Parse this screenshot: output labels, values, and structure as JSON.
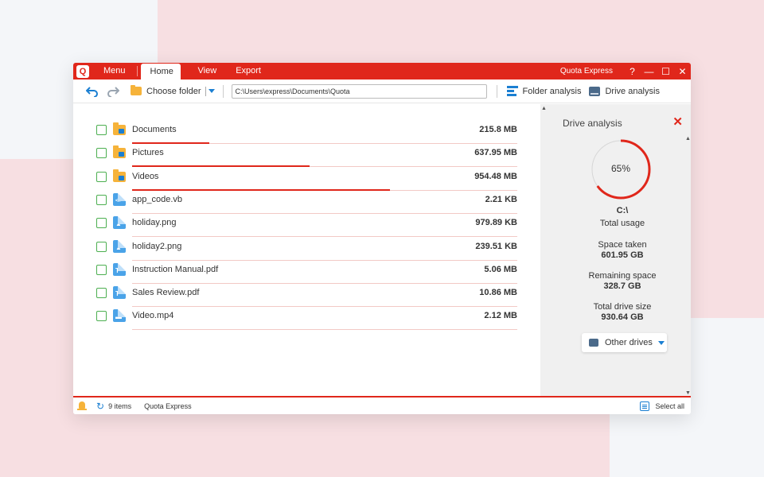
{
  "app": {
    "logo": "Q",
    "title": "Quota Express",
    "tabs": {
      "menu": "Menu",
      "home": "Home",
      "view": "View",
      "export": "Export"
    },
    "window_controls": {
      "help": "?",
      "minimize": "—",
      "maximize": "☐",
      "close": "✕"
    }
  },
  "toolbar": {
    "choose_folder": "Choose folder",
    "path": "C:\\Users\\express\\Documents\\Quota",
    "folder_analysis": "Folder analysis",
    "drive_analysis": "Drive analysis"
  },
  "files": [
    {
      "name": "Documents",
      "size": "215.8 MB",
      "type": "folder",
      "fraction": 0.2
    },
    {
      "name": "Pictures",
      "size": "637.95 MB",
      "type": "folder",
      "fraction": 0.46
    },
    {
      "name": "Videos",
      "size": "954.48 MB",
      "type": "folder",
      "fraction": 0.67
    },
    {
      "name": "app_code.vb",
      "size": "2.21 KB",
      "type": "code",
      "fraction": 0
    },
    {
      "name": "holiday.png",
      "size": "979.89 KB",
      "type": "image",
      "fraction": 0
    },
    {
      "name": "holiday2.png",
      "size": "239.51 KB",
      "type": "image",
      "fraction": 0
    },
    {
      "name": "Instruction Manual.pdf",
      "size": "5.06 MB",
      "type": "doc",
      "fraction": 0
    },
    {
      "name": "Sales Review.pdf",
      "size": "10.86 MB",
      "type": "doc",
      "fraction": 0
    },
    {
      "name": "Video.mp4",
      "size": "2.12 MB",
      "type": "video",
      "fraction": 0
    }
  ],
  "drive_panel": {
    "title": "Drive analysis",
    "usage_percent": 65,
    "usage_label": "65%",
    "drive": "C:\\",
    "total_usage_label": "Total usage",
    "space_taken_label": "Space taken",
    "space_taken": "601.95 GB",
    "remaining_label": "Remaining space",
    "remaining": "328.7 GB",
    "total_label": "Total drive size",
    "total": "930.64 GB",
    "other_drives": "Other drives"
  },
  "status": {
    "items": "9 items",
    "app_name": "Quota Express",
    "select_all": "Select all"
  },
  "colors": {
    "brand": "#e0271b",
    "accent": "#1b7fd2",
    "folder": "#f6b33a",
    "checkbox": "#4caf50"
  }
}
